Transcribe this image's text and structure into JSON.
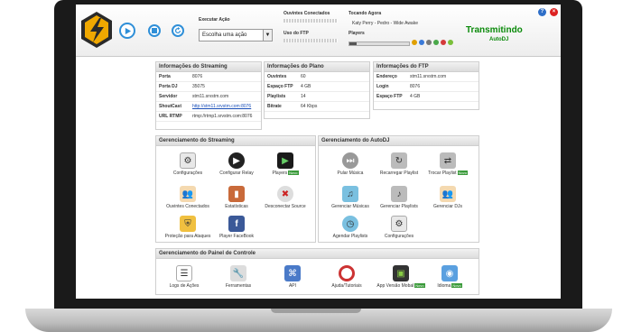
{
  "header": {
    "action_label": "Executar Ação",
    "action_select": "Escolha uma ação",
    "listeners_label": "Ouvintes Conectados",
    "ftp_label": "Uso do FTP",
    "now_playing_label": "Tocando Agora",
    "now_playing_value": "Katy Perry - Pedro - Wide Awake",
    "players_label": "Players",
    "status_title": "Transmitindo",
    "status_sub": "AutoDJ"
  },
  "streaming_info": {
    "title": "Informações do Streaming",
    "rows": [
      {
        "k": "Porta",
        "v": "8076"
      },
      {
        "k": "Porta DJ",
        "v": "35075"
      },
      {
        "k": "Servidor",
        "v": "stm11.srvstm.com"
      },
      {
        "k": "ShoutCast",
        "v": "http://stm11.srvstm.com:8076"
      },
      {
        "k": "URL RTMP",
        "v": "rtmp://rtmp1.srvstm.com:8076"
      }
    ]
  },
  "plan_info": {
    "title": "Informações do Plano",
    "rows": [
      {
        "k": "Ouvintes",
        "v": "60"
      },
      {
        "k": "Espaço FTP",
        "v": "4 GB"
      },
      {
        "k": "Playlists",
        "v": "14"
      },
      {
        "k": "Bitrate",
        "v": "64 Kbps"
      }
    ]
  },
  "ftp_info": {
    "title": "Informações do FTP",
    "rows": [
      {
        "k": "Endereço",
        "v": "stm11.srvstm.com"
      },
      {
        "k": "Login",
        "v": "8076"
      },
      {
        "k": "Espaço FTP",
        "v": "4 GB"
      }
    ]
  },
  "streaming_mgmt": {
    "title": "Gerenciamento do Streaming",
    "items": [
      {
        "label": "Configurações",
        "icon": "settings-icon"
      },
      {
        "label": "Configurar Relay",
        "icon": "play-icon"
      },
      {
        "label": "Players",
        "icon": "players-icon",
        "badge": "Novo"
      },
      {
        "label": "Ouvintes Conectados",
        "icon": "users-icon"
      },
      {
        "label": "Estatísticas",
        "icon": "stats-icon"
      },
      {
        "label": "Desconectar Source",
        "icon": "disconnect-icon"
      },
      {
        "label": "Proteção para Ataques",
        "icon": "shield-icon"
      },
      {
        "label": "Player FaceBook",
        "icon": "facebook-icon"
      }
    ]
  },
  "autodj_mgmt": {
    "title": "Gerenciamento do AutoDJ",
    "items": [
      {
        "label": "Pular Música",
        "icon": "skip-icon"
      },
      {
        "label": "Recarregar Playlist",
        "icon": "reload-icon"
      },
      {
        "label": "Trocar Playlist",
        "icon": "swap-icon",
        "badge": "Novo"
      },
      {
        "label": "Gerenciar Músicas",
        "icon": "music-folder-icon"
      },
      {
        "label": "Gerenciar Playlists",
        "icon": "playlist-icon"
      },
      {
        "label": "Gerenciar DJs",
        "icon": "djs-icon"
      },
      {
        "label": "Agendar Playlists",
        "icon": "schedule-icon"
      },
      {
        "label": "Configurações",
        "icon": "settings-icon"
      }
    ]
  },
  "panel_mgmt": {
    "title": "Gerenciamento do Painel de Controle",
    "items": [
      {
        "label": "Logs de Ações",
        "icon": "logs-icon"
      },
      {
        "label": "Ferramentas",
        "icon": "tools-icon"
      },
      {
        "label": "API",
        "icon": "api-icon"
      },
      {
        "label": "Ajuda/Tutoriais",
        "icon": "help-icon"
      },
      {
        "label": "App Versão Mobal",
        "icon": "android-icon",
        "badge": "Novo"
      },
      {
        "label": "Idioma",
        "icon": "language-icon",
        "badge": "Novo"
      }
    ]
  },
  "badge_text": "Novo"
}
